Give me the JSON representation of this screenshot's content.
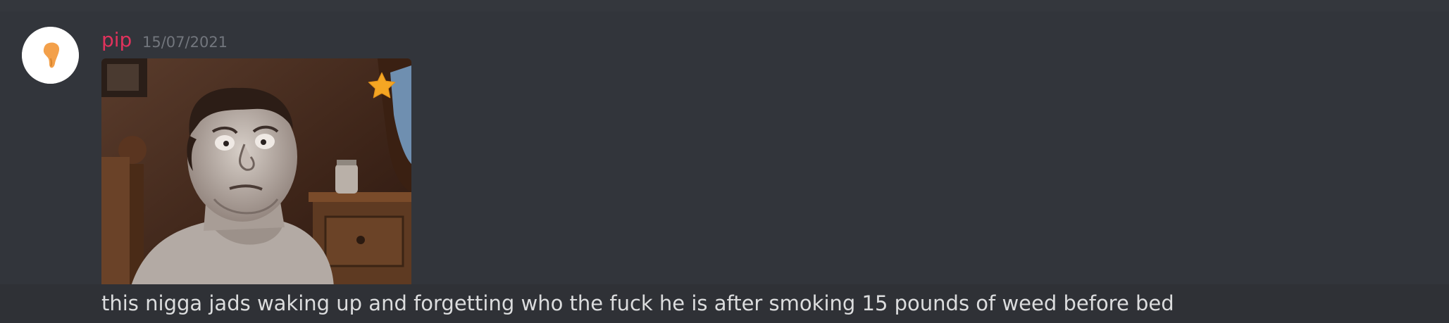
{
  "message": {
    "author": "pip",
    "author_color": "#e0325c",
    "timestamp": "15/07/2021",
    "avatar_icon": "orange-blob-avatar",
    "attachment": {
      "type": "animated-gif",
      "description_icon": "cartoon-man-in-bed-image",
      "star_icon": "star-icon",
      "star_color": "#f5a623"
    },
    "text": "this nigga jads waking up and forgetting who the fuck he is after smoking 15 pounds of weed before bed"
  }
}
